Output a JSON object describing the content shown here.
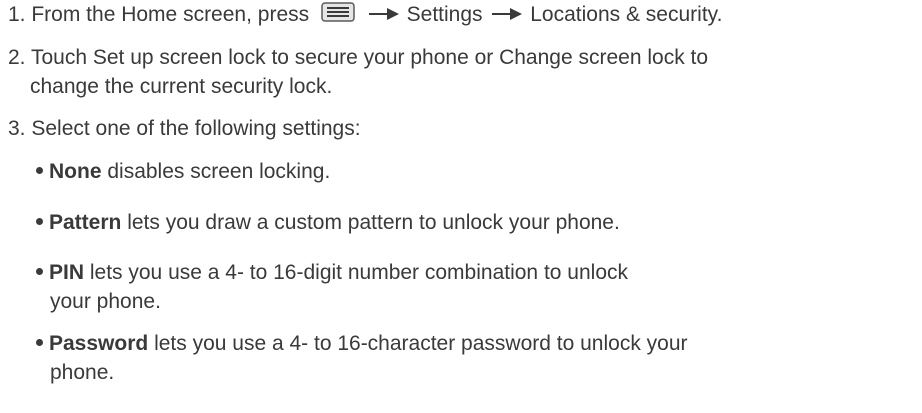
{
  "steps": [
    {
      "number": "1.",
      "text_before": "From the Home screen, press",
      "menu_key_icon": "menu-key-icon",
      "crumb_1": "Settings",
      "crumb_2": "Locations & security."
    },
    {
      "number": "2.",
      "line_1": "Touch Set up screen lock to secure your phone or Change screen lock to",
      "line_2": "change the current security lock."
    },
    {
      "number": "3.",
      "text": "Select one of the following settings:"
    }
  ],
  "options": [
    {
      "term": "None",
      "desc_1": "disables screen locking.",
      "desc_2": ""
    },
    {
      "term": "Pattern",
      "desc_1": "lets you draw a custom pattern to unlock your phone.",
      "desc_2": ""
    },
    {
      "term": "PIN",
      "desc_1": "lets you use a 4- to 16-digit number combination to unlock",
      "desc_2": "your phone."
    },
    {
      "term": "Password",
      "desc_1": "lets you use a 4- to 16-character password to unlock your",
      "desc_2": "phone."
    }
  ],
  "colors": {
    "text": "#3a3a3a"
  }
}
